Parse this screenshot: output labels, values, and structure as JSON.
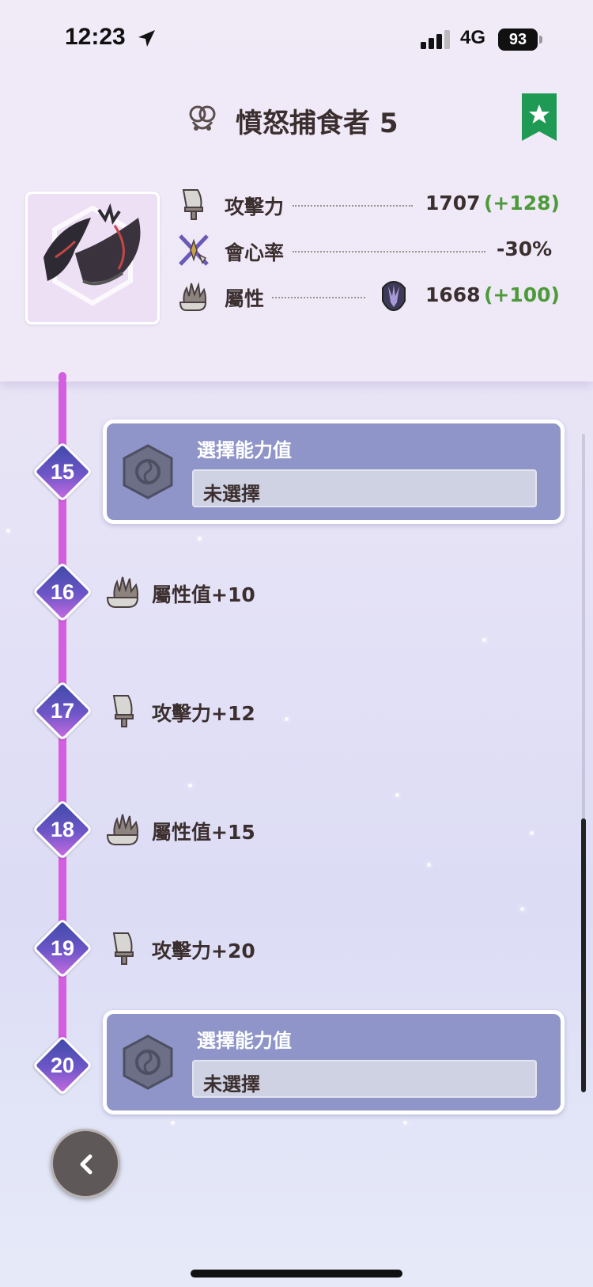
{
  "status_bar": {
    "time": "12:23",
    "network": "4G",
    "battery": "93"
  },
  "header": {
    "title": "憤怒捕食者 5"
  },
  "stats": [
    {
      "label": "攻擊力",
      "value": "1707",
      "bonus": "(+128)"
    },
    {
      "label": "會心率",
      "value": "-30%",
      "bonus": ""
    },
    {
      "label": "屬性",
      "value": "1668",
      "bonus": "(+100)"
    }
  ],
  "levels": [
    {
      "num": "15",
      "type": "choice",
      "title": "選擇能力值",
      "value": "未選擇"
    },
    {
      "num": "16",
      "type": "reward",
      "icon": "element-icon",
      "text": "屬性值+10"
    },
    {
      "num": "17",
      "type": "reward",
      "icon": "attack-icon",
      "text": "攻擊力+12"
    },
    {
      "num": "18",
      "type": "reward",
      "icon": "element-icon",
      "text": "屬性值+15"
    },
    {
      "num": "19",
      "type": "reward",
      "icon": "attack-icon",
      "text": "攻擊力+20"
    },
    {
      "num": "20",
      "type": "choice",
      "title": "選擇能力值",
      "value": "未選擇"
    }
  ],
  "colors": {
    "track": "#d45ee0",
    "bonus": "#4d9a3a",
    "card": "#8f95c8",
    "bookmark": "#1f9a55"
  }
}
